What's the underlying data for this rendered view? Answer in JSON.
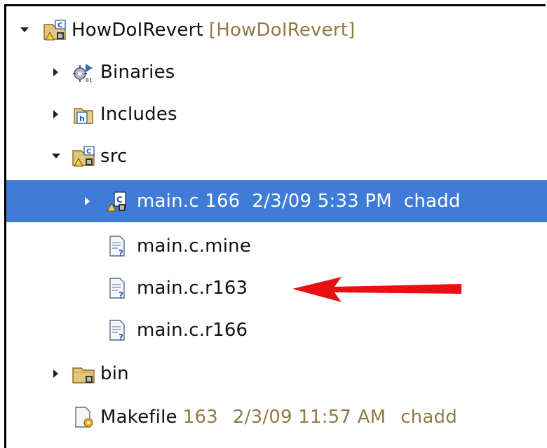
{
  "tree": {
    "project": {
      "label": "HowDoIRevert",
      "decoration": "[HowDoIRevert]"
    },
    "binaries": {
      "label": "Binaries"
    },
    "includes": {
      "label": "Includes"
    },
    "src": {
      "label": "src"
    },
    "main_c": {
      "label": "main.c",
      "revision": "166",
      "date": "2/3/09 5:33 PM",
      "author": "chadd"
    },
    "main_c_mine": {
      "label": "main.c.mine"
    },
    "main_c_r163": {
      "label": "main.c.r163"
    },
    "main_c_r166": {
      "label": "main.c.r166"
    },
    "bin": {
      "label": "bin"
    },
    "makefile": {
      "label": "Makefile",
      "revision": "163",
      "date": "2/3/09 11:57 AM",
      "author": "chadd"
    }
  },
  "colors": {
    "selection": "#3f7cd8",
    "decoration_text": "#8f7b44",
    "annotation_arrow": "#e81010"
  },
  "icons": {
    "project": "c-project-icon",
    "binaries": "binaries-icon",
    "includes": "includes-icon",
    "src": "source-folder-icon",
    "main_c": "c-source-file-icon",
    "unversioned_file": "unversioned-file-icon",
    "bin": "folder-icon",
    "makefile": "makefile-icon"
  }
}
